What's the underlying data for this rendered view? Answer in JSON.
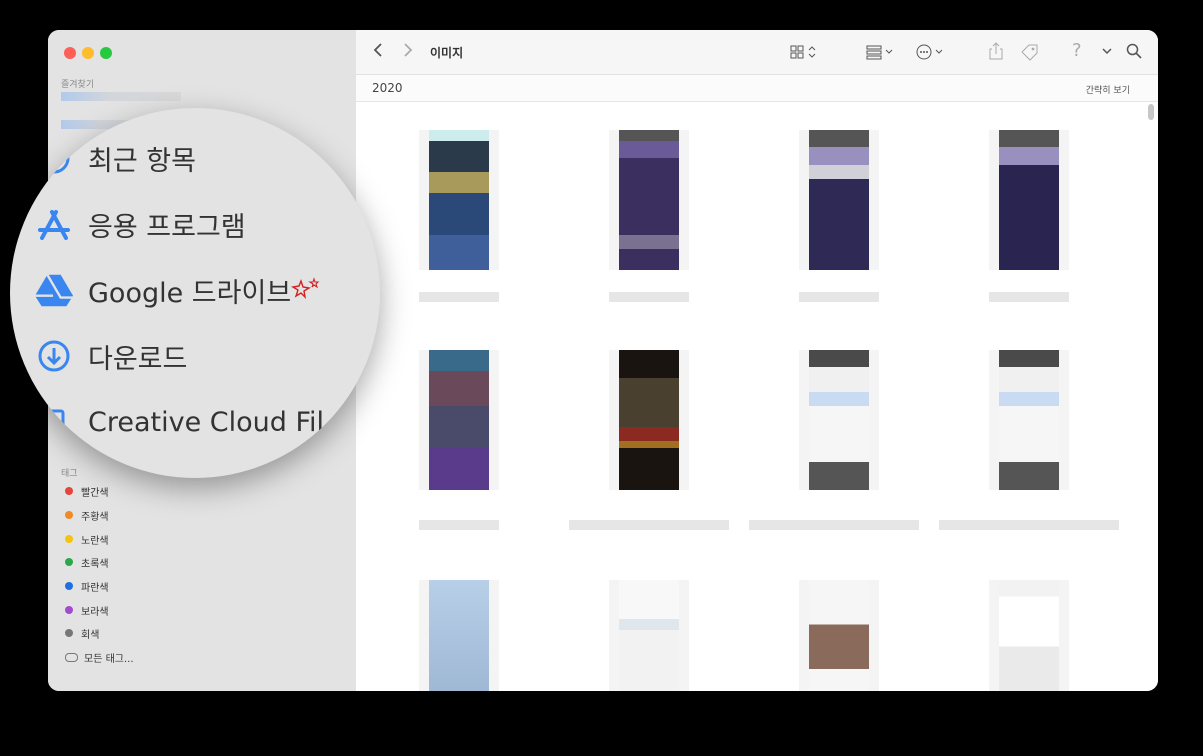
{
  "window": {
    "title": "이미지"
  },
  "sidebar": {
    "favorites_label": "즐겨찾기",
    "tags_label": "태그",
    "tags": [
      {
        "label": "빨간색",
        "color": "#e5453b"
      },
      {
        "label": "주황색",
        "color": "#f08a24"
      },
      {
        "label": "노란색",
        "color": "#f5c211"
      },
      {
        "label": "초록색",
        "color": "#2aa84a"
      },
      {
        "label": "파란색",
        "color": "#1f6fe0"
      },
      {
        "label": "보라색",
        "color": "#a24bd0"
      },
      {
        "label": "회색",
        "color": "#777777"
      }
    ],
    "all_tags": "모든 태그..."
  },
  "magnifier": {
    "items": [
      {
        "label": "최근 항목",
        "icon": "clock-icon"
      },
      {
        "label": "응용 프로그램",
        "icon": "applications-icon"
      },
      {
        "label": "Google 드라이브",
        "icon": "google-drive-icon"
      },
      {
        "label": "다운로드",
        "icon": "download-icon"
      },
      {
        "label": "Creative Cloud Fil",
        "icon": "creative-cloud-icon"
      }
    ]
  },
  "toolbar": {
    "title": "이미지"
  },
  "section": {
    "year": "2020",
    "show_less": "간략히 보기"
  },
  "colors": {
    "accent": "#3a86f0",
    "sidebar_bg": "#e3e3e3"
  }
}
